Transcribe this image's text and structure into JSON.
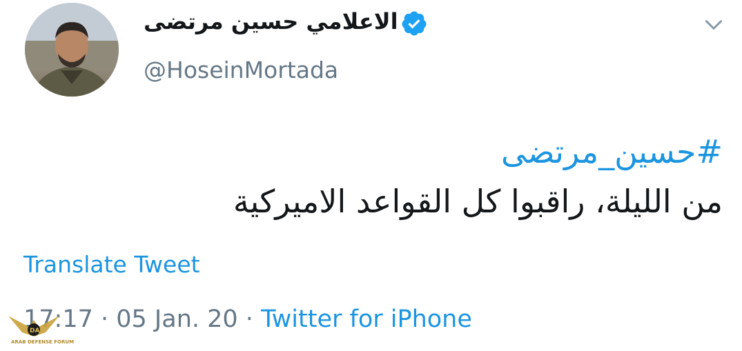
{
  "tweet": {
    "author": {
      "display_name": "الاعلامي حسين مرتضى",
      "username": "@HoseinMortada",
      "verified": true,
      "avatar_icon": "profile-photo"
    },
    "hashtag": "#حسين_مرتضى",
    "text": "من الليلة، راقبوا كل القواعد الاميركية",
    "translate_label": "Translate Tweet",
    "time": "17:17",
    "date": "05 Jan. 20",
    "separator": " · ",
    "source": "Twitter for iPhone",
    "menu_icon": "chevron-down-icon"
  },
  "watermark": {
    "logo_text": "ARAB DEFENSE FORUM"
  },
  "colors": {
    "link": "#1b95e0",
    "secondary_text": "#657786",
    "primary_text": "#14171a",
    "verified_badge": "#1da1f2"
  }
}
